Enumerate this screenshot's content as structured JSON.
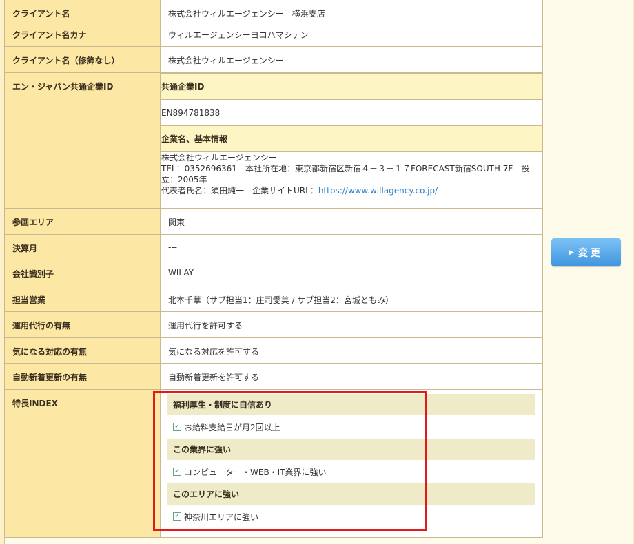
{
  "rows": {
    "client_name": {
      "label": "クライアント名",
      "value": "株式会社ウィルエージェンシー　横浜支店"
    },
    "client_kana": {
      "label": "クライアント名カナ",
      "value": "ウィルエージェンシーヨコハマシテン"
    },
    "client_plain": {
      "label": "クライアント名（修飾なし）",
      "value": "株式会社ウィルエージェンシー"
    },
    "en_id": {
      "label": "エン・ジャパン共通企業ID",
      "id_header": "共通企業ID",
      "id_value": "EN894781838",
      "info_header": "企業名、基本情報",
      "info_line1": "株式会社ウィルエージェンシー",
      "info_line2": "TEL：0352696361　本社所在地：東京都新宿区新宿４－３－１７FORECAST新宿SOUTH 7F　設立：2005年",
      "info_line3_prefix": "代表者氏名：須田純一　企業サイトURL：",
      "info_url": "https://www.willagency.co.jp/"
    },
    "area": {
      "label": "参画エリア",
      "value": "関東"
    },
    "fiscal": {
      "label": "決算月",
      "value": "---"
    },
    "company_code": {
      "label": "会社識別子",
      "value": "WILAY"
    },
    "sales": {
      "label": "担当営業",
      "value": "北本千華（サブ担当1：庄司愛美 / サブ担当2：宮城ともみ）"
    },
    "proxy": {
      "label": "運用代行の有無",
      "value": "運用代行を許可する"
    },
    "concern": {
      "label": "気になる対応の有無",
      "value": "気になる対応を許可する"
    },
    "auto_update": {
      "label": "自動新着更新の有無",
      "value": "自動新着更新を許可する"
    },
    "features": {
      "label": "特長INDEX",
      "groups": [
        {
          "title": "福利厚生・制度に自信あり",
          "item": "お給料支給日が月2回以上"
        },
        {
          "title": "この業界に強い",
          "item": "コンピューター・WEB・IT業界に強い"
        },
        {
          "title": "このエリアに強い",
          "item": "神奈川エリアに強い"
        }
      ]
    }
  },
  "change_button": "変更",
  "colors": {
    "label_bg": "#fce7a4",
    "button": "#4fa3e6",
    "highlight": "#e11b1b"
  }
}
